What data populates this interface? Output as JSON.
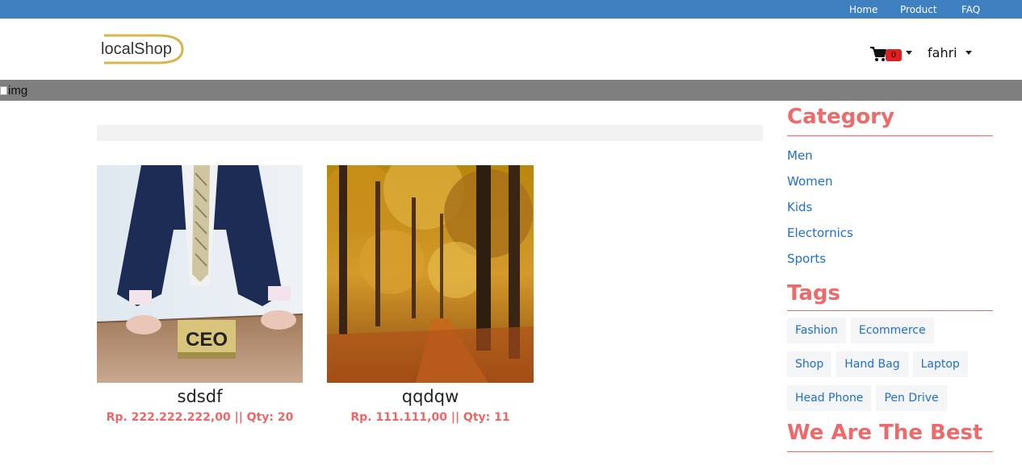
{
  "topnav": {
    "home": "Home",
    "product": "Product",
    "faq": "FAQ"
  },
  "header": {
    "logo": "localShop",
    "cart_count": "0",
    "user": "fahri"
  },
  "banner": {
    "img_alt": "img"
  },
  "products": [
    {
      "name": "sdsdf",
      "price": "Rp. 222.222.222,00 || Qty: 20",
      "image": "ceo-photo"
    },
    {
      "name": "qqdqw",
      "price": "Rp. 111.111,00 || Qty: 11",
      "image": "autumn-forest-photo"
    }
  ],
  "sidebar": {
    "category_heading": "Category",
    "categories": [
      "Men",
      "Women",
      "Kids",
      "Electornics",
      "Sports"
    ],
    "tags_heading": "Tags",
    "tags": [
      "Fashion",
      "Ecommerce",
      "Shop",
      "Hand Bag",
      "Laptop",
      "Head Phone",
      "Pen Drive"
    ],
    "best_heading": "We Are The Best"
  },
  "colors": {
    "topbar": "#3d7fbf",
    "accent": "#ee6a6a",
    "link": "#1f6fd0",
    "logo_arc": "#d4b84e",
    "badge": "#e02020"
  }
}
